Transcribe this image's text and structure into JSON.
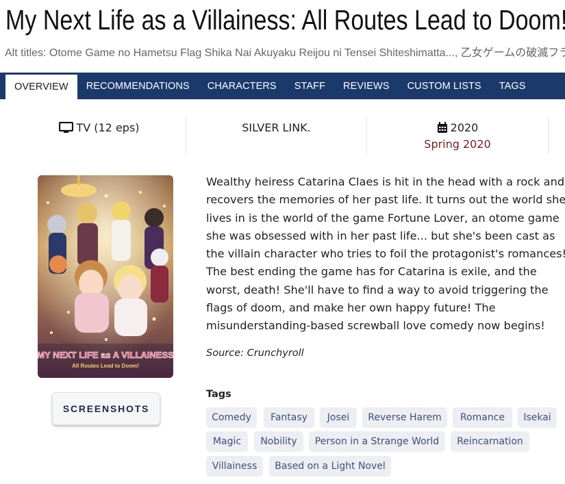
{
  "title": "My Next Life as a Villainess: All Routes Lead to Doom!",
  "alt_titles": "Alt titles: Otome Game no Hametsu Flag Shika Nai Akuyaku Reijou ni Tensei Shiteshimatta..., 乙女ゲームの破滅フラグしか",
  "nav": {
    "items": [
      "OVERVIEW",
      "RECOMMENDATIONS",
      "CHARACTERS",
      "STAFF",
      "REVIEWS",
      "CUSTOM LISTS",
      "TAGS"
    ],
    "active": "OVERVIEW"
  },
  "info": {
    "format": "TV (12 eps)",
    "studio": "SILVER LINK.",
    "year": "2020",
    "season": "Spring 2020",
    "format_icon": "monitor-icon",
    "year_icon": "calendar-icon"
  },
  "poster": {
    "logo_line1": "MY NEXT LIFE as A VILLAINESS",
    "logo_line2": "All Routes Lead to Doom!"
  },
  "screenshots_label": "SCREENSHOTS",
  "description": "Wealthy heiress Catarina Claes is hit in the head with a rock and recovers the memories of her past life. It turns out the world she lives in is the world of the game Fortune Lover, an otome game she was obsessed with in her past life... but she's been cast as the villain character who tries to foil the protagonist's romances! The best ending the game has for Catarina is exile, and the worst, death! She'll have to find a way to avoid triggering the flags of doom, and make her own happy future! The misunderstanding-based screwball love comedy now begins!",
  "source": "Source: Crunchyroll",
  "tags_title": "Tags",
  "tags": [
    "Comedy",
    "Fantasy",
    "Josei",
    "Reverse Harem",
    "Romance",
    "Isekai",
    "Magic",
    "Nobility",
    "Person in a Strange World",
    "Reincarnation",
    "Villainess",
    "Based on a Light Novel"
  ],
  "colors": {
    "nav_bg": "#1b3a6b",
    "accent_red": "#7a1c1c",
    "tag_bg": "#eceef2",
    "tag_text": "#3c4f7b"
  }
}
